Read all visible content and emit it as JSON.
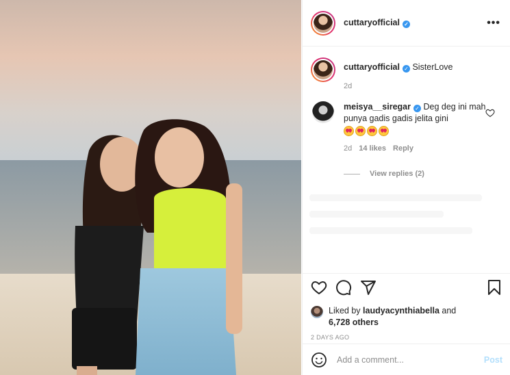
{
  "post": {
    "author": "cuttaryofficial",
    "photo_description_icon": "photo-icon",
    "caption_author": "cuttaryofficial",
    "caption_text": "SisterLove",
    "caption_time": "2d",
    "verified_icon": "verified-badge-icon"
  },
  "comments": [
    {
      "user": "meisya__siregar",
      "text": "Deg deg ini mah punya gadis gadis jelita gini",
      "emoji_count": 4,
      "time": "2d",
      "likes": "14 likes",
      "reply_label": "Reply",
      "view_replies": "View replies (2)"
    }
  ],
  "actions": {
    "like_icon": "heart-icon",
    "comment_icon": "comment-icon",
    "share_icon": "share-icon",
    "save_icon": "bookmark-icon",
    "liked_by_prefix": "Liked by",
    "liked_by_user": "laudyacynthiabella",
    "liked_by_and": "and",
    "liked_by_others": "6,728 others",
    "post_date": "2 DAYS AGO"
  },
  "add_comment": {
    "placeholder": "Add a comment...",
    "post_label": "Post",
    "emoji_icon": "emoji-icon"
  },
  "colors": {
    "accent": "#3897f0",
    "post_button_disabled": "#b2dffc",
    "muted_text": "#8e8e8e"
  }
}
